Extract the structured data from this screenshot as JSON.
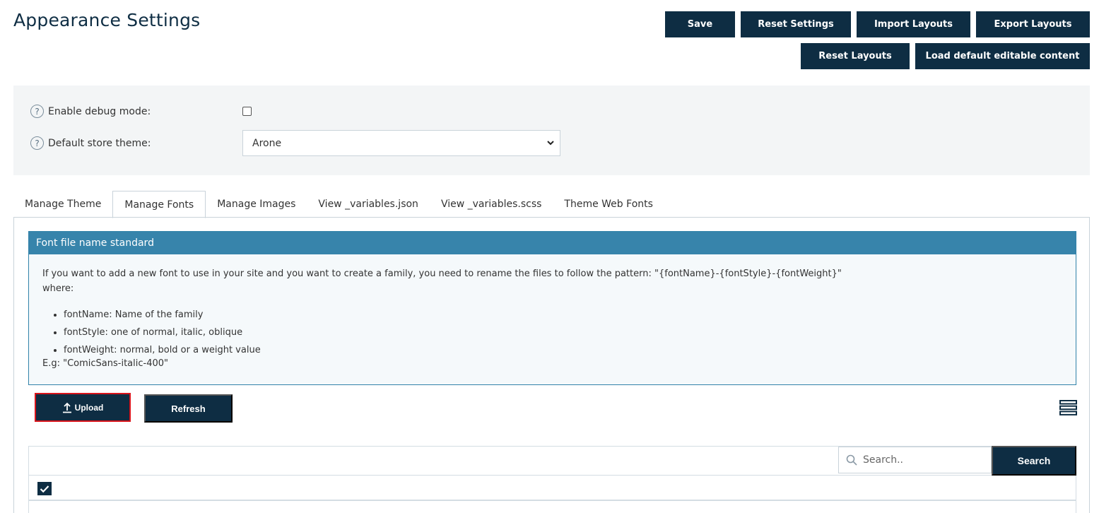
{
  "page": {
    "title": "Appearance Settings"
  },
  "toolbar": {
    "save": "Save",
    "reset_settings": "Reset Settings",
    "import_layouts": "Import Layouts",
    "export_layouts": "Export Layouts",
    "reset_layouts": "Reset Layouts",
    "load_default": "Load default editable content"
  },
  "settings": {
    "debug_label": "Enable debug mode:",
    "debug_checked": false,
    "theme_label": "Default store theme:",
    "theme_value": "Arone"
  },
  "tabs": [
    {
      "label": "Manage Theme",
      "active": false
    },
    {
      "label": "Manage Fonts",
      "active": true
    },
    {
      "label": "Manage Images",
      "active": false
    },
    {
      "label": "View _variables.json",
      "active": false
    },
    {
      "label": "View _variables.scss",
      "active": false
    },
    {
      "label": "Theme Web Fonts",
      "active": false
    }
  ],
  "info": {
    "header": "Font file name standard",
    "intro": "If you want to add a new font to use in your site and you want to create a family, you need to rename the files to follow the pattern: \"{fontName}-{fontStyle}-{fontWeight}\"",
    "where": "where:",
    "items": [
      "fontName: Name of the family",
      "fontStyle: one of normal, italic, oblique",
      "fontWeight: normal, bold or a weight value"
    ],
    "example": "E.g: \"ComicSans-italic-400\""
  },
  "actions": {
    "upload": "Upload",
    "refresh": "Refresh"
  },
  "grid": {
    "search_placeholder": "Search..",
    "search_button": "Search",
    "select_all_checked": true
  },
  "colors": {
    "primary": "#0e2d43",
    "info_header": "#3784ab",
    "highlight_border": "#d9141b"
  }
}
